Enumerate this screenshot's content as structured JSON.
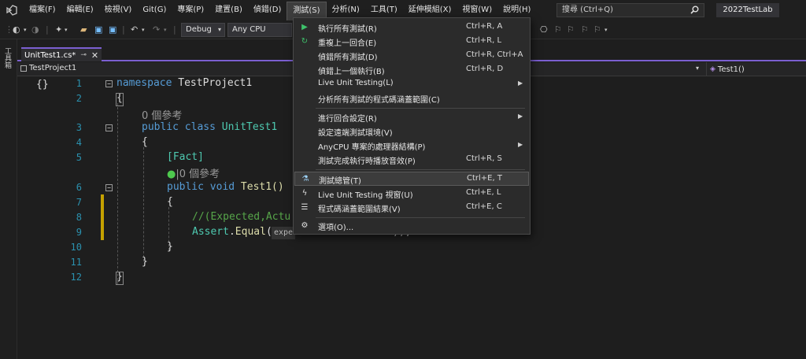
{
  "menubar": {
    "items": [
      "檔案(F)",
      "編輯(E)",
      "檢視(V)",
      "Git(G)",
      "專案(P)",
      "建置(B)",
      "偵錯(D)",
      "測試(S)",
      "分析(N)",
      "工具(T)",
      "延伸模組(X)",
      "視窗(W)",
      "說明(H)"
    ],
    "search_placeholder": "搜尋 (Ctrl+Q)",
    "project_name": "2022TestLab"
  },
  "toolbar": {
    "config": "Debug",
    "platform": "Any CPU"
  },
  "toolstrip": {
    "label": "工具箱"
  },
  "tab": {
    "label": "UnitTest1.cs*",
    "pin": "⊸",
    "close": "✕"
  },
  "navbar": {
    "project": "TestProject1",
    "member": "Test1()"
  },
  "editor": {
    "indicator": "{}",
    "line_numbers": [
      "1",
      "2",
      "3",
      "4",
      "5",
      "6",
      "7",
      "8",
      "9",
      "10",
      "11",
      "12"
    ],
    "ref_class": "0 個參考",
    "ref_method": "|0 個參考",
    "line1_kw": "namespace",
    "line1_name": " TestProject1",
    "line2": "{",
    "line3_kw": "public class",
    "line3_name": " UnitTest1",
    "line4": "{",
    "line5": "[Fact]",
    "line6_kw": "public void",
    "line6_fn": " Test1()",
    "line7": "{",
    "line8": "//(Expected,Actu",
    "line9_obj": "Assert",
    "line9_dot": ".",
    "line9_fn": "Equal",
    "line9_paren": "(",
    "line9_hint": "expe",
    "line9_tail": "));",
    "line10": "}",
    "line11": "}",
    "line12": "}"
  },
  "dropdown": {
    "items": [
      {
        "label": "執行所有測試(R)",
        "shortcut": "Ctrl+R, A"
      },
      {
        "label": "重複上一回合(E)",
        "shortcut": "Ctrl+R, L"
      },
      {
        "label": "偵錯所有測試(D)",
        "shortcut": "Ctrl+R, Ctrl+A"
      },
      {
        "label": "偵錯上一個執行(B)",
        "shortcut": "Ctrl+R, D"
      },
      {
        "label": "Live Unit Testing(L)",
        "shortcut": ""
      },
      {
        "label": "分析所有測試的程式碼涵蓋範圍(C)",
        "shortcut": ""
      },
      {
        "label": "進行回合設定(R)",
        "shortcut": ""
      },
      {
        "label": "設定遠端測試環境(V)",
        "shortcut": ""
      },
      {
        "label": "AnyCPU 專案的處理器結構(P)",
        "shortcut": ""
      },
      {
        "label": "測試完成執行時播放音效(P)",
        "shortcut": "Ctrl+R, S"
      },
      {
        "label": "測試總管(T)",
        "shortcut": "Ctrl+E, T"
      },
      {
        "label": "Live Unit Testing 視窗(U)",
        "shortcut": "Ctrl+E, L"
      },
      {
        "label": "程式碼涵蓋範圍結果(V)",
        "shortcut": "Ctrl+E, C"
      },
      {
        "label": "選項(O)...",
        "shortcut": ""
      }
    ]
  },
  "colors": {
    "accent": "#7b5fd0",
    "keyword": "#569cd6",
    "type": "#4ec9b0",
    "comment": "#57a64a"
  }
}
